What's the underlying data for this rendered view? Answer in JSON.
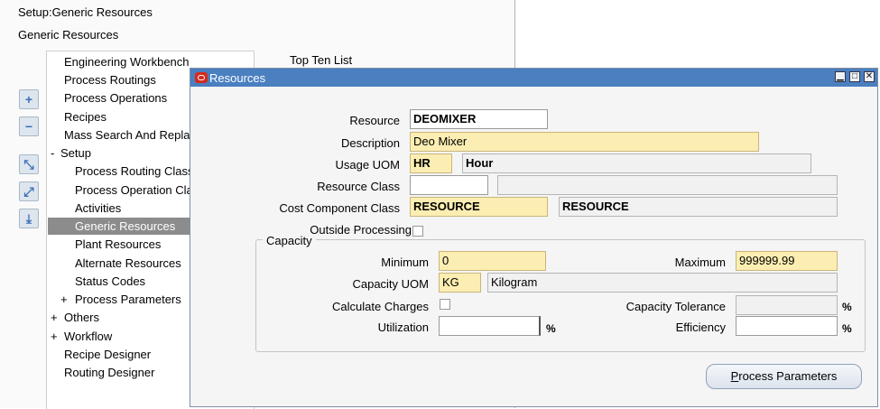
{
  "background": {
    "breadcrumb": "Setup:Generic Resources",
    "section_title": "Generic Resources",
    "top_ten": "Top Ten List",
    "tree": [
      {
        "label": "Engineering Workbench",
        "prefix": ""
      },
      {
        "label": "Process Routings",
        "prefix": ""
      },
      {
        "label": "Process Operations",
        "prefix": ""
      },
      {
        "label": "Recipes",
        "prefix": ""
      },
      {
        "label": "Mass Search And Replace",
        "prefix": ""
      },
      {
        "label": "Setup",
        "prefix": "-"
      },
      {
        "label": "Process Routing Classes",
        "prefix": ""
      },
      {
        "label": "Process Operation Classes",
        "prefix": ""
      },
      {
        "label": "Activities",
        "prefix": ""
      },
      {
        "label": "Generic Resources",
        "prefix": "",
        "selected": true
      },
      {
        "label": "Plant Resources",
        "prefix": ""
      },
      {
        "label": "Alternate Resources",
        "prefix": ""
      },
      {
        "label": "Status Codes",
        "prefix": ""
      },
      {
        "label": "Process Parameters",
        "prefix": "+"
      },
      {
        "label": "Others",
        "prefix": "+"
      },
      {
        "label": "Workflow",
        "prefix": "+"
      },
      {
        "label": "Recipe Designer",
        "prefix": ""
      },
      {
        "label": "Routing Designer",
        "prefix": ""
      }
    ],
    "side_buttons": [
      "+",
      "−",
      "⤡",
      "⤢",
      "⤓"
    ]
  },
  "window": {
    "title": "Resources",
    "controls": {
      "minimize": "▁",
      "maximize": "□",
      "close": "✕"
    },
    "resource_label": "Resource",
    "resource_value": "DEOMIXER",
    "description_label": "Description",
    "description_value": "Deo Mixer",
    "usage_uom_label": "Usage UOM",
    "usage_uom_code": "HR",
    "usage_uom_name": "Hour",
    "resource_class_label": "Resource Class",
    "resource_class_value": "",
    "resource_class_desc": "",
    "cost_component_label": "Cost Component Class",
    "cost_component_code": "RESOURCE",
    "cost_component_desc": "RESOURCE",
    "outside_processing_label": "Outside Processing",
    "capacity": {
      "title": "Capacity",
      "minimum_label": "Minimum",
      "minimum_value": "0",
      "maximum_label": "Maximum",
      "maximum_value": "999999.99",
      "uom_label": "Capacity UOM",
      "uom_code": "KG",
      "uom_name": "Kilogram",
      "calc_charges_label": "Calculate Charges",
      "tolerance_label": "Capacity Tolerance",
      "tolerance_value": "",
      "utilization_label": "Utilization",
      "utilization_value": "",
      "efficiency_label": "Efficiency",
      "efficiency_value": "",
      "percent": "%"
    },
    "process_parameters_button": "Process Parameters"
  }
}
